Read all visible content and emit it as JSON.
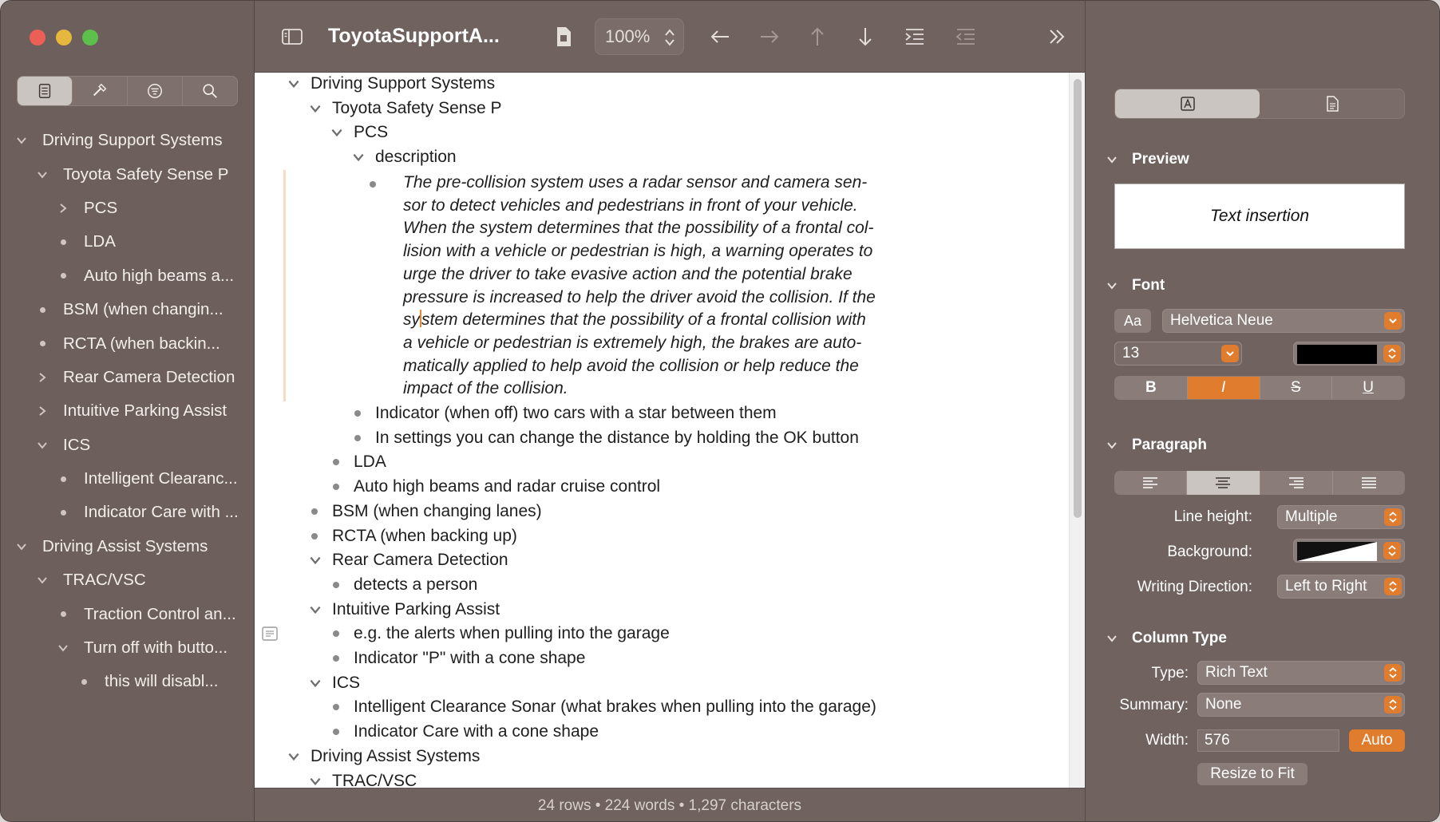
{
  "window": {
    "title": "ToyotaSupportA...",
    "zoom": "100%"
  },
  "sidebar": {
    "tabs": [
      "outline-icon",
      "hammer-icon",
      "filter-icon",
      "search-icon"
    ],
    "tree": [
      {
        "label": "Driving Support Systems",
        "depth": 0,
        "mark": "open"
      },
      {
        "label": "Toyota Safety Sense P",
        "depth": 1,
        "mark": "open"
      },
      {
        "label": "PCS",
        "depth": 2,
        "mark": "closed"
      },
      {
        "label": "LDA",
        "depth": 2,
        "mark": "dot"
      },
      {
        "label": "Auto high beams a...",
        "depth": 2,
        "mark": "dot"
      },
      {
        "label": "BSM (when changin...",
        "depth": 1,
        "mark": "dot"
      },
      {
        "label": "RCTA (when backin...",
        "depth": 1,
        "mark": "dot"
      },
      {
        "label": "Rear Camera Detection",
        "depth": 1,
        "mark": "closed"
      },
      {
        "label": "Intuitive Parking Assist",
        "depth": 1,
        "mark": "closed"
      },
      {
        "label": "ICS",
        "depth": 1,
        "mark": "open"
      },
      {
        "label": "Intelligent Clearanc...",
        "depth": 2,
        "mark": "dot"
      },
      {
        "label": "Indicator Care with ...",
        "depth": 2,
        "mark": "dot"
      },
      {
        "label": "Driving Assist Systems",
        "depth": 0,
        "mark": "open"
      },
      {
        "label": "TRAC/VSC",
        "depth": 1,
        "mark": "open"
      },
      {
        "label": "Traction Control an...",
        "depth": 2,
        "mark": "dot"
      },
      {
        "label": "Turn off with butto...",
        "depth": 2,
        "mark": "open"
      },
      {
        "label": "this will disabl...",
        "depth": 3,
        "mark": "dot"
      }
    ]
  },
  "outline": {
    "rows": [
      {
        "label": "Driving Support Systems",
        "depth": 0,
        "mark": "open"
      },
      {
        "label": "Toyota Safety Sense P",
        "depth": 1,
        "mark": "open"
      },
      {
        "label": "PCS",
        "depth": 2,
        "mark": "open"
      },
      {
        "label": "description",
        "depth": 3,
        "mark": "open"
      }
    ],
    "paragraph_lines": [
      "The pre-collision system uses a radar sensor and camera sen-",
      "sor to detect vehicles and pedestrians in front of your vehicle.",
      "When the system determines that the possibility of a frontal col-",
      "lision with a vehicle or pedestrian is high, a warning operates to",
      "urge the driver to take evasive action and the potential brake",
      "pressure is increased to help the driver avoid the collision. If the",
      "system determines that the possibility of a frontal collision with",
      "a vehicle or pedestrian is extremely high, the brakes are auto-",
      "matically applied to help avoid the collision or help reduce the",
      "impact of the collision."
    ],
    "rows_after": [
      {
        "label": "Indicator (when off) two cars with a star between them",
        "depth": 3,
        "mark": "dot"
      },
      {
        "label": "In settings you can change the distance by holding the OK button",
        "depth": 3,
        "mark": "dot"
      },
      {
        "label": "LDA",
        "depth": 2,
        "mark": "dot"
      },
      {
        "label": "Auto high beams and radar cruise control",
        "depth": 2,
        "mark": "dot"
      },
      {
        "label": "BSM (when changing lanes)",
        "depth": 1,
        "mark": "dot"
      },
      {
        "label": "RCTA (when backing up)",
        "depth": 1,
        "mark": "dot"
      },
      {
        "label": "Rear Camera Detection",
        "depth": 1,
        "mark": "open"
      },
      {
        "label": "detects a person",
        "depth": 2,
        "mark": "dot"
      },
      {
        "label": "Intuitive Parking Assist",
        "depth": 1,
        "mark": "open"
      },
      {
        "label": "e.g. the alerts when pulling into the garage",
        "depth": 2,
        "mark": "dot"
      },
      {
        "label": "Indicator \"P\" with a cone shape",
        "depth": 2,
        "mark": "dot"
      },
      {
        "label": "ICS",
        "depth": 1,
        "mark": "open"
      },
      {
        "label": "Intelligent Clearance Sonar (what brakes when pulling into the garage)",
        "depth": 2,
        "mark": "dot"
      },
      {
        "label": "Indicator Care with a cone shape",
        "depth": 2,
        "mark": "dot"
      },
      {
        "label": "Driving Assist Systems",
        "depth": 0,
        "mark": "open"
      },
      {
        "label": "TRAC/VSC",
        "depth": 1,
        "mark": "open"
      }
    ]
  },
  "status": {
    "text": "24 rows • 224 words • 1,297 characters"
  },
  "inspector": {
    "preview": {
      "heading": "Preview",
      "sample": "Text insertion"
    },
    "font": {
      "heading": "Font",
      "aa": "Aa",
      "family": "Helvetica Neue",
      "size": "13",
      "color": "#000000",
      "bold": "B",
      "italic": "I",
      "strike": "S",
      "underline": "U"
    },
    "paragraph": {
      "heading": "Paragraph",
      "line_height_label": "Line height:",
      "line_height": "Multiple",
      "background_label": "Background:",
      "direction_label": "Writing Direction:",
      "direction": "Left to Right"
    },
    "column": {
      "heading": "Column Type",
      "type_label": "Type:",
      "type": "Rich Text",
      "summary_label": "Summary:",
      "summary": "None",
      "width_label": "Width:",
      "width": "576",
      "auto": "Auto",
      "resize": "Resize to Fit"
    }
  },
  "colors": {
    "accent": "#e07c2d",
    "chrome": "#6f625f"
  }
}
